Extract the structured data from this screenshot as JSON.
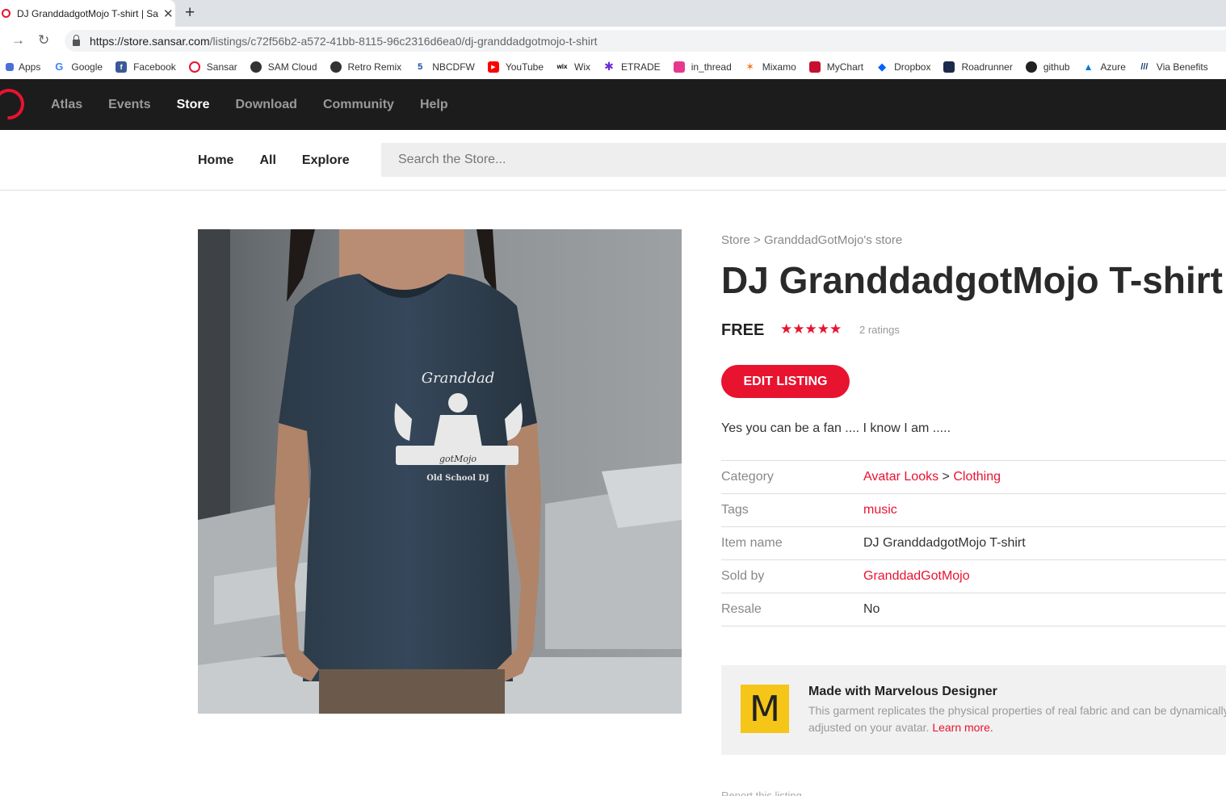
{
  "browser": {
    "tab_title": "DJ GranddadgotMojo T-shirt | Sa",
    "url_host": "https://store.sansar.com",
    "url_path": "/listings/c72f56b2-a572-41bb-8115-96c2316d6ea0/dj-granddadgotmojo-t-shirt",
    "bookmarks": [
      "Apps",
      "Google",
      "Facebook",
      "Sansar",
      "SAM Cloud",
      "Retro Remix",
      "NBCDFW",
      "YouTube",
      "Wix",
      "ETRADE",
      "in_thread",
      "Mixamo",
      "MyChart",
      "Dropbox",
      "Roadrunner",
      "github",
      "Azure",
      "Via Benefits"
    ]
  },
  "site_nav": {
    "items": [
      "Atlas",
      "Events",
      "Store",
      "Download",
      "Community",
      "Help"
    ],
    "active": "Store"
  },
  "store_nav": {
    "home": "Home",
    "all": "All",
    "explore": "Explore",
    "search_placeholder": "Search the Store..."
  },
  "product": {
    "breadcrumb": "Store > GranddadGotMojo's store",
    "title": "DJ GranddadgotMojo T-shirt",
    "price": "FREE",
    "stars": "★★★★★",
    "rating_count": "2 ratings",
    "edit_button": "EDIT LISTING",
    "description": "Yes you can be a fan .... I know I am .....",
    "image_texts": {
      "top": "Granddad",
      "middle": "gotMojo",
      "bottom": "Old School DJ"
    }
  },
  "specs": {
    "category_label": "Category",
    "category_parent": "Avatar Looks",
    "category_sep": " > ",
    "category_child": "Clothing",
    "tags_label": "Tags",
    "tags_value": "music",
    "item_name_label": "Item name",
    "item_name_value": "DJ GranddadgotMojo T-shirt",
    "sold_by_label": "Sold by",
    "sold_by_value": "GranddadGotMojo",
    "resale_label": "Resale",
    "resale_value": "No"
  },
  "marvelous": {
    "logo_letter": "M",
    "title": "Made with Marvelous Designer",
    "text": "This garment replicates the physical properties of real fabric and can be dynamically adjusted on your avatar. ",
    "link": "Learn more."
  },
  "footer": {
    "report": "Report this listing"
  },
  "colors": {
    "accent": "#e8132f",
    "header_bg": "#1c1c1c",
    "marvelous_yellow": "#f5c518"
  }
}
